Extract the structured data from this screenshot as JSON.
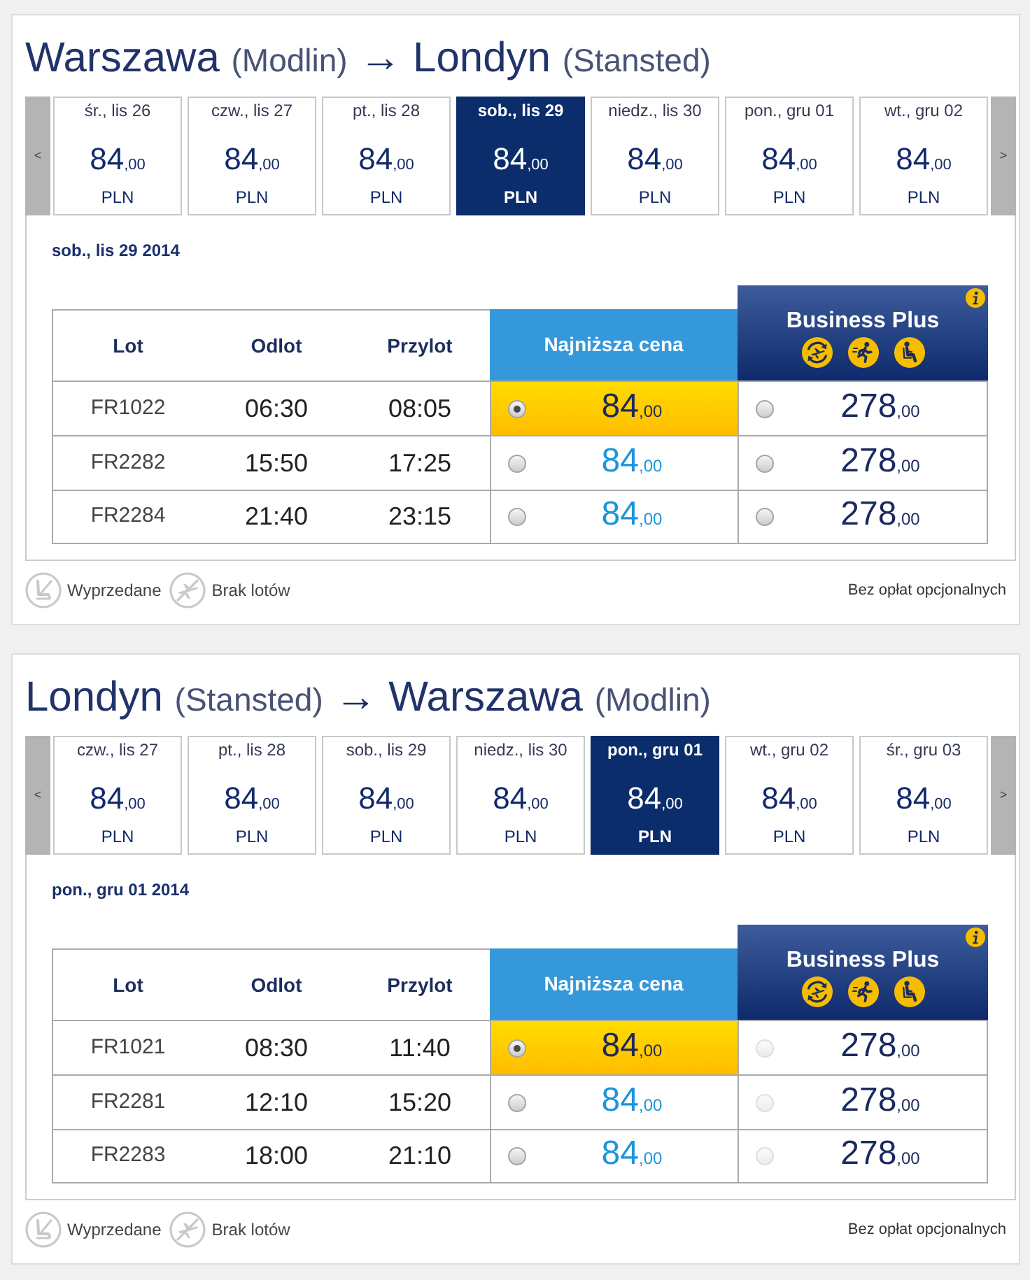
{
  "sections": [
    {
      "title": {
        "origin": "Warszawa",
        "origin_airport": "(Modlin)",
        "arrow": "→",
        "destination": "Londyn",
        "destination_airport": "(Stansted)"
      },
      "date_nav": {
        "prev": "<",
        "next": ">"
      },
      "dates": [
        {
          "label": "śr., lis 26",
          "amount": "84",
          "decimals": ",00",
          "currency": "PLN",
          "selected": false
        },
        {
          "label": "czw., lis 27",
          "amount": "84",
          "decimals": ",00",
          "currency": "PLN",
          "selected": false
        },
        {
          "label": "pt., lis 28",
          "amount": "84",
          "decimals": ",00",
          "currency": "PLN",
          "selected": false
        },
        {
          "label": "sob., lis 29",
          "amount": "84",
          "decimals": ",00",
          "currency": "PLN",
          "selected": true
        },
        {
          "label": "niedz., lis 30",
          "amount": "84",
          "decimals": ",00",
          "currency": "PLN",
          "selected": false
        },
        {
          "label": "pon., gru 01",
          "amount": "84",
          "decimals": ",00",
          "currency": "PLN",
          "selected": false
        },
        {
          "label": "wt., gru 02",
          "amount": "84",
          "decimals": ",00",
          "currency": "PLN",
          "selected": false
        }
      ],
      "date_heading": "sob., lis 29 2014",
      "table": {
        "columns": [
          "Lot",
          "Odlot",
          "Przylot"
        ],
        "fare_columns": [
          {
            "kind": "standard",
            "label": "Najniższa cena"
          },
          {
            "kind": "business",
            "label": "Business Plus"
          }
        ],
        "rows": [
          {
            "flight": "FR1022",
            "departure": "06:30",
            "arrival": "08:05",
            "fares": [
              {
                "amount": "84",
                "decimals": ",00",
                "selected": true,
                "disabled": false
              },
              {
                "amount": "278",
                "decimals": ",00",
                "selected": false,
                "disabled": false
              }
            ]
          },
          {
            "flight": "FR2282",
            "departure": "15:50",
            "arrival": "17:25",
            "fares": [
              {
                "amount": "84",
                "decimals": ",00",
                "selected": false,
                "disabled": false
              },
              {
                "amount": "278",
                "decimals": ",00",
                "selected": false,
                "disabled": false
              }
            ]
          },
          {
            "flight": "FR2284",
            "departure": "21:40",
            "arrival": "23:15",
            "fares": [
              {
                "amount": "84",
                "decimals": ",00",
                "selected": false,
                "disabled": false
              },
              {
                "amount": "278",
                "decimals": ",00",
                "selected": false,
                "disabled": false
              }
            ]
          }
        ]
      },
      "legend": [
        {
          "kind": "sold_out",
          "label": "Wyprzedane"
        },
        {
          "kind": "no_flights",
          "label": "Brak lotów"
        }
      ],
      "fees_note": "Bez opłat opcjonalnych"
    },
    {
      "title": {
        "origin": "Londyn",
        "origin_airport": "(Stansted)",
        "arrow": "→",
        "destination": "Warszawa",
        "destination_airport": "(Modlin)"
      },
      "date_nav": {
        "prev": "<",
        "next": ">"
      },
      "dates": [
        {
          "label": "czw., lis 27",
          "amount": "84",
          "decimals": ",00",
          "currency": "PLN",
          "selected": false
        },
        {
          "label": "pt., lis 28",
          "amount": "84",
          "decimals": ",00",
          "currency": "PLN",
          "selected": false
        },
        {
          "label": "sob., lis 29",
          "amount": "84",
          "decimals": ",00",
          "currency": "PLN",
          "selected": false
        },
        {
          "label": "niedz., lis 30",
          "amount": "84",
          "decimals": ",00",
          "currency": "PLN",
          "selected": false
        },
        {
          "label": "pon., gru 01",
          "amount": "84",
          "decimals": ",00",
          "currency": "PLN",
          "selected": true
        },
        {
          "label": "wt., gru 02",
          "amount": "84",
          "decimals": ",00",
          "currency": "PLN",
          "selected": false
        },
        {
          "label": "śr., gru 03",
          "amount": "84",
          "decimals": ",00",
          "currency": "PLN",
          "selected": false
        }
      ],
      "date_heading": "pon., gru 01 2014",
      "table": {
        "columns": [
          "Lot",
          "Odlot",
          "Przylot"
        ],
        "fare_columns": [
          {
            "kind": "standard",
            "label": "Najniższa cena"
          },
          {
            "kind": "business",
            "label": "Business Plus"
          }
        ],
        "rows": [
          {
            "flight": "FR1021",
            "departure": "08:30",
            "arrival": "11:40",
            "fares": [
              {
                "amount": "84",
                "decimals": ",00",
                "selected": true,
                "disabled": false
              },
              {
                "amount": "278",
                "decimals": ",00",
                "selected": false,
                "disabled": true
              }
            ]
          },
          {
            "flight": "FR2281",
            "departure": "12:10",
            "arrival": "15:20",
            "fares": [
              {
                "amount": "84",
                "decimals": ",00",
                "selected": false,
                "disabled": false
              },
              {
                "amount": "278",
                "decimals": ",00",
                "selected": false,
                "disabled": true
              }
            ]
          },
          {
            "flight": "FR2283",
            "departure": "18:00",
            "arrival": "21:10",
            "fares": [
              {
                "amount": "84",
                "decimals": ",00",
                "selected": false,
                "disabled": false
              },
              {
                "amount": "278",
                "decimals": ",00",
                "selected": false,
                "disabled": true
              }
            ]
          }
        ]
      },
      "legend": [
        {
          "kind": "sold_out",
          "label": "Wyprzedane"
        },
        {
          "kind": "no_flights",
          "label": "Brak lotów"
        }
      ],
      "fees_note": "Bez opłat opcjonalnych"
    }
  ]
}
